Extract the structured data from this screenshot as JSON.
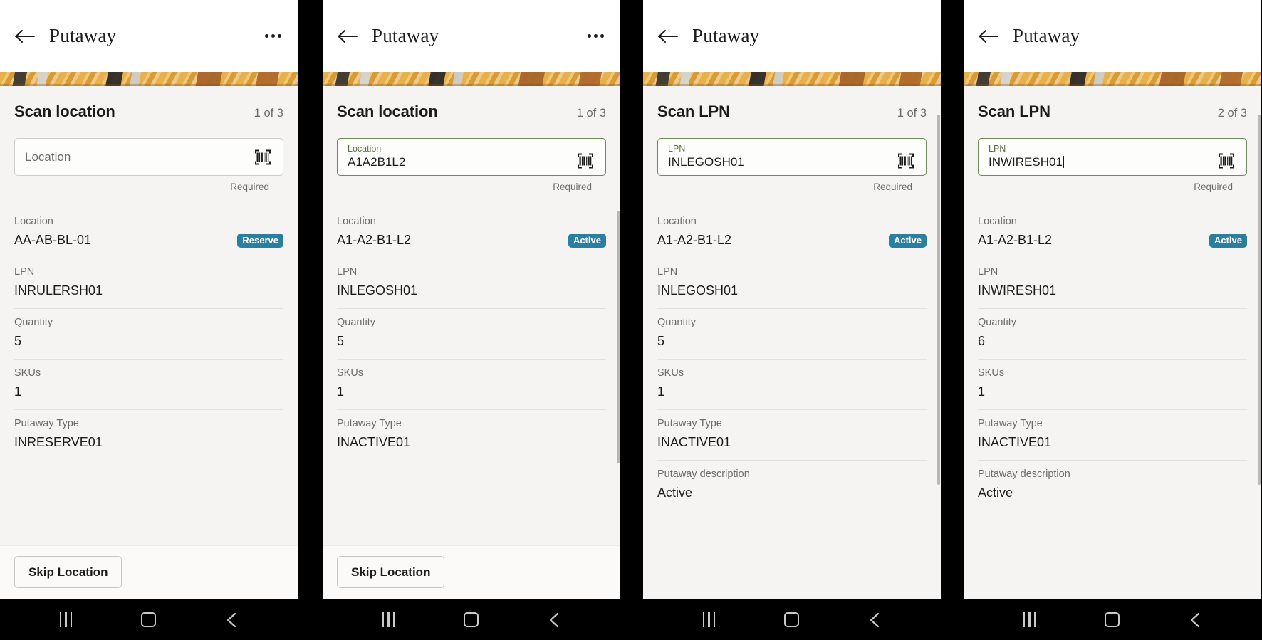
{
  "app": {
    "title": "Putaway",
    "back_icon": "arrow-left-icon",
    "overflow_icon": "kebab-menu-icon",
    "barcode_icon": "barcode-scan-icon",
    "accent_green": "#6f8a5a",
    "badge_teal": "#2a7fa0",
    "screen_bg": "#f5f4f2"
  },
  "navbar": {
    "recents_label": "recents-icon",
    "home_label": "home-icon",
    "back_label": "back-icon"
  },
  "labels": {
    "location": "Location",
    "lpn": "LPN",
    "quantity": "Quantity",
    "skus": "SKUs",
    "putaway_type": "Putaway Type",
    "putaway_description": "Putaway description",
    "required": "Required",
    "skip_location": "Skip Location"
  },
  "panels": [
    {
      "title": "Putaway",
      "has_overflow": true,
      "step_title": "Scan location",
      "step_count": "1 of 3",
      "input": {
        "name": "location-input",
        "label": "Location",
        "placeholder": "Location",
        "value": "",
        "state": "empty",
        "helper": "Required",
        "caret": false
      },
      "details": [
        {
          "label": "Location",
          "value": "AA-AB-BL-01",
          "badge": "Reserve"
        },
        {
          "label": "LPN",
          "value": "INRULERSH01",
          "badge": ""
        },
        {
          "label": "Quantity",
          "value": "5",
          "badge": ""
        },
        {
          "label": "SKUs",
          "value": "1",
          "badge": ""
        },
        {
          "label": "Putaway Type",
          "value": "INRESERVE01",
          "badge": ""
        }
      ],
      "footer_button": "Skip Location",
      "has_footer": true,
      "has_scrollbar": false
    },
    {
      "title": "Putaway",
      "has_overflow": true,
      "step_title": "Scan location",
      "step_count": "1 of 3",
      "input": {
        "name": "location-input",
        "label": "Location",
        "placeholder": "Location",
        "value": "A1A2B1L2",
        "state": "filled",
        "helper": "Required",
        "caret": false
      },
      "details": [
        {
          "label": "Location",
          "value": "A1-A2-B1-L2",
          "badge": "Active"
        },
        {
          "label": "LPN",
          "value": "INLEGOSH01",
          "badge": ""
        },
        {
          "label": "Quantity",
          "value": "5",
          "badge": ""
        },
        {
          "label": "SKUs",
          "value": "1",
          "badge": ""
        },
        {
          "label": "Putaway Type",
          "value": "INACTIVE01",
          "badge": ""
        }
      ],
      "footer_button": "Skip Location",
      "has_footer": true,
      "has_scrollbar": true
    },
    {
      "title": "Putaway",
      "has_overflow": false,
      "step_title": "Scan LPN",
      "step_count": "1 of 3",
      "input": {
        "name": "lpn-input",
        "label": "LPN",
        "placeholder": "LPN",
        "value": "INLEGOSH01",
        "state": "filled",
        "helper": "Required",
        "caret": false
      },
      "details": [
        {
          "label": "Location",
          "value": "A1-A2-B1-L2",
          "badge": "Active"
        },
        {
          "label": "LPN",
          "value": "INLEGOSH01",
          "badge": ""
        },
        {
          "label": "Quantity",
          "value": "5",
          "badge": ""
        },
        {
          "label": "SKUs",
          "value": "1",
          "badge": ""
        },
        {
          "label": "Putaway Type",
          "value": "INACTIVE01",
          "badge": ""
        },
        {
          "label": "Putaway description",
          "value": "Active",
          "badge": ""
        }
      ],
      "footer_button": "",
      "has_footer": false,
      "has_scrollbar": true
    },
    {
      "title": "Putaway",
      "has_overflow": false,
      "step_title": "Scan LPN",
      "step_count": "2 of 3",
      "input": {
        "name": "lpn-input",
        "label": "LPN",
        "placeholder": "LPN",
        "value": "INWIRESH01",
        "state": "filled",
        "helper": "Required",
        "caret": true
      },
      "details": [
        {
          "label": "Location",
          "value": "A1-A2-B1-L2",
          "badge": "Active"
        },
        {
          "label": "LPN",
          "value": "INWIRESH01",
          "badge": ""
        },
        {
          "label": "Quantity",
          "value": "6",
          "badge": ""
        },
        {
          "label": "SKUs",
          "value": "1",
          "badge": ""
        },
        {
          "label": "Putaway Type",
          "value": "INACTIVE01",
          "badge": ""
        },
        {
          "label": "Putaway description",
          "value": "Active",
          "badge": ""
        }
      ],
      "footer_button": "",
      "has_footer": false,
      "has_scrollbar": true
    }
  ]
}
